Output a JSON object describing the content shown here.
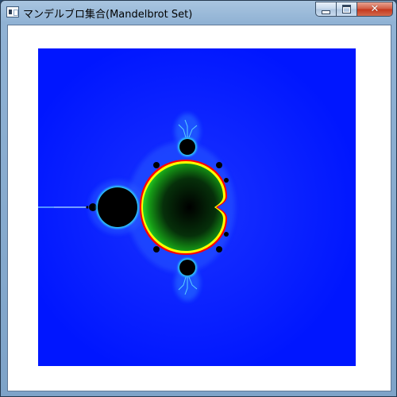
{
  "window": {
    "title": "マンデルブロ集合(Mandelbrot Set)",
    "controls": {
      "minimize_icon": "minimize-icon",
      "maximize_icon": "maximize-icon",
      "close_label": "✕"
    }
  },
  "fractal": {
    "image_name": "mandelbrot-set",
    "background_color": "#0016ff",
    "set_color": "#000000",
    "glow_colors": [
      "#1f6bff",
      "#23c6ff",
      "#ffffff"
    ],
    "boundary_colors": [
      "#ff0000",
      "#ffff00",
      "#00cc00",
      "#003300"
    ]
  }
}
